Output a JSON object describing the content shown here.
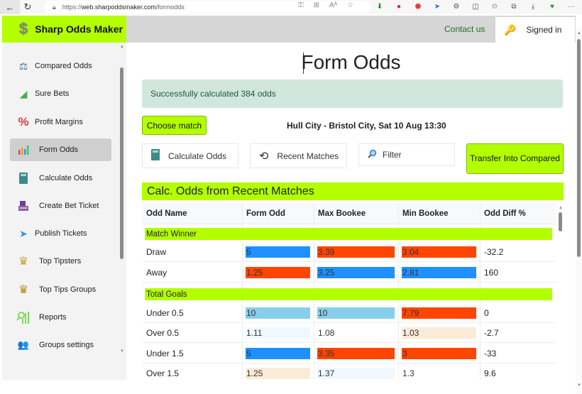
{
  "browser": {
    "url_prefix": "https://",
    "url_host": "web.sharpoddsmaker.com",
    "url_path": "/formodds",
    "back_icon": "←",
    "reload_icon": "↻",
    "lock_icon": "🔒",
    "more_icon": "···"
  },
  "header": {
    "brand_icon": "$",
    "brand_name": "Sharp Odds Maker",
    "contact_label": "Contact us",
    "signed_in_label": "Signed in",
    "key_icon": "🔑"
  },
  "sidebar": {
    "items": [
      {
        "label": "Compared Odds",
        "icon": "⚖",
        "color": "#3a6f9a"
      },
      {
        "label": "Sure Bets",
        "icon": "◢",
        "color": "#4caf50"
      },
      {
        "label": "Profit Margins",
        "icon": "%",
        "color": "#e53935"
      },
      {
        "label": "Form Odds",
        "icon": "▮",
        "color": "#f39c12",
        "active": true
      },
      {
        "label": "Calculate Odds",
        "icon": "▦",
        "color": "#3d8a8a"
      },
      {
        "label": "Create Bet Ticket",
        "icon": "▣",
        "color": "#6a3fa0"
      },
      {
        "label": "Publish Tickets",
        "icon": "➤",
        "color": "#3f8fd8"
      },
      {
        "label": "Top Tipsters",
        "icon": "♛",
        "color": "#c9a227"
      },
      {
        "label": "Top Tips Groups",
        "icon": "♛",
        "color": "#b8860b"
      },
      {
        "label": "Reports",
        "icon": "▥",
        "color": "#7ed957"
      },
      {
        "label": "Groups settings",
        "icon": "👥",
        "color": "#c08a3a"
      }
    ]
  },
  "main": {
    "title": "Form Odds",
    "alert": "Successfully calculated 384 odds",
    "choose_match_label": "Choose match",
    "match_info": "Hull City - Bristol City, Sat 10 Aug 13:30",
    "calculate_odds_label": "Calculate Odds",
    "recent_matches_label": "Recent Matches",
    "filter_label": "Filter",
    "transfer_label": "Transfer Into Compared",
    "section_title": "Calc. Odds from Recent Matches",
    "table": {
      "headers": [
        "Odd Name",
        "Form Odd",
        "Max Bookee",
        "Min Bookee",
        "Odd Diff %"
      ],
      "groups": [
        {
          "name": "Match Winner",
          "rows": [
            {
              "name": "Draw",
              "form": "5",
              "form_color": "#1e90ff",
              "max": "3.39",
              "max_color": "#ff4500",
              "min": "3.04",
              "min_color": "#ff4500",
              "diff": "-32.2"
            },
            {
              "name": "Away",
              "form": "1.25",
              "form_color": "#ff4500",
              "max": "3.25",
              "max_color": "#1e90ff",
              "min": "2.81",
              "min_color": "#1e90ff",
              "diff": "160"
            }
          ]
        },
        {
          "name": "Total Goals",
          "rows": [
            {
              "name": "Under 0.5",
              "form": "10",
              "form_color": "#87ceeb",
              "max": "10",
              "max_color": "#87ceeb",
              "min": "7.79",
              "min_color": "#ff4500",
              "diff": "0"
            },
            {
              "name": "Over 0.5",
              "form": "1.11",
              "form_color": "#f0f8ff",
              "max": "1.08",
              "max_color": "#ffffff",
              "min": "1.03",
              "min_color": "#faebd7",
              "diff": "-2.7"
            },
            {
              "name": "Under 1.5",
              "form": "5",
              "form_color": "#1e90ff",
              "max": "3.35",
              "max_color": "#ff4500",
              "min": "3",
              "min_color": "#ff4500",
              "diff": "-33"
            },
            {
              "name": "Over 1.5",
              "form": "1.25",
              "form_color": "#faebd7",
              "max": "1.37",
              "max_color": "#f0f8ff",
              "min": "1.3",
              "min_color": "#ffffff",
              "diff": "9.6"
            }
          ]
        }
      ]
    }
  },
  "colors": {
    "accent": "#b3ff00",
    "alert_bg": "#d1e7dd",
    "higher": "#1e90ff",
    "lower": "#ff4500"
  }
}
